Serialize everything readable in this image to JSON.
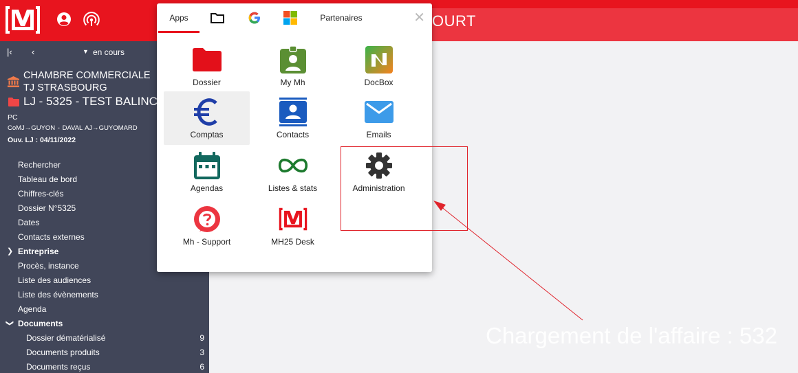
{
  "topbar": {
    "title": "OURT"
  },
  "sidebar": {
    "nav": {
      "status_label": "en cours"
    },
    "court_line1": "CHAMBRE COMMERCIALE",
    "court_line2": "TJ STRASBOURG",
    "case_title": "LJ - 5325 - TEST BALINCO",
    "procedure": "PC",
    "actors": "CoMJ→GUYON - DAVAL   AJ→GUYOMARD",
    "opening": "Ouv. LJ : 04/11/2022",
    "menu": [
      {
        "label": "Rechercher"
      },
      {
        "label": "Tableau de bord"
      },
      {
        "label": "Chiffres-clés"
      },
      {
        "label": "Dossier N°5325"
      },
      {
        "label": "Dates"
      },
      {
        "label": "Contacts externes"
      },
      {
        "label": "Entreprise"
      },
      {
        "label": "Procès, instance"
      },
      {
        "label": "Liste des audiences"
      },
      {
        "label": "Liste des évènements"
      },
      {
        "label": "Agenda"
      },
      {
        "label": "Documents"
      },
      {
        "label": "Dossier dématérialisé",
        "count": "9"
      },
      {
        "label": "Documents produits",
        "count": "3"
      },
      {
        "label": "Documents reçus",
        "count": "6"
      }
    ]
  },
  "content": {
    "loading_message": "Chargement de l'affaire : 532"
  },
  "popup": {
    "tabs": [
      {
        "label": "Apps"
      },
      {
        "label": "Partenaires"
      }
    ],
    "apps": [
      {
        "label": "Dossier"
      },
      {
        "label": "My Mh"
      },
      {
        "label": "DocBox"
      },
      {
        "label": "Comptas"
      },
      {
        "label": "Contacts"
      },
      {
        "label": "Emails"
      },
      {
        "label": "Agendas"
      },
      {
        "label": "Listes & stats"
      },
      {
        "label": "Administration"
      },
      {
        "label": "Mh - Support"
      },
      {
        "label": "MH25 Desk"
      }
    ]
  },
  "colors": {
    "brand_red": "#e8141e",
    "sidebar_bg": "#414659"
  }
}
